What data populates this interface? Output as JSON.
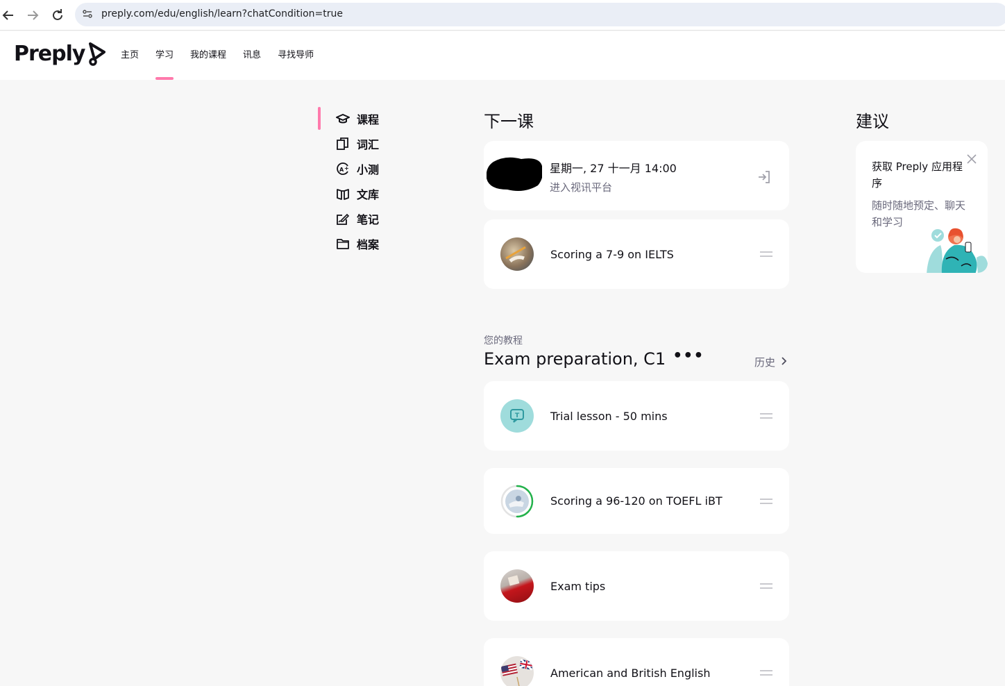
{
  "browser": {
    "url": "preply.com/edu/english/learn?chatCondition=true"
  },
  "header": {
    "logo_text": "Preply",
    "nav": [
      {
        "label": "主页",
        "active": false
      },
      {
        "label": "学习",
        "active": true
      },
      {
        "label": "我的课程",
        "active": false
      },
      {
        "label": "讯息",
        "active": false
      },
      {
        "label": "寻找导师",
        "active": false
      }
    ]
  },
  "sidebar": {
    "items": [
      {
        "label": "课程",
        "icon": "graduation-cap-icon",
        "active": true
      },
      {
        "label": "词汇",
        "icon": "cards-icon",
        "active": false
      },
      {
        "label": "小测",
        "icon": "quiz-icon",
        "active": false
      },
      {
        "label": "文库",
        "icon": "book-icon",
        "active": false
      },
      {
        "label": "笔记",
        "icon": "notes-icon",
        "active": false
      },
      {
        "label": "档案",
        "icon": "folder-icon",
        "active": false
      }
    ]
  },
  "next_lesson": {
    "section_title": "下一课",
    "date": "星期一, 27 十一月 14:00",
    "join_label": "进入视讯平台",
    "material_title": "Scoring a 7-9 on IELTS"
  },
  "course": {
    "label": "您的教程",
    "title": "Exam preparation, C1",
    "more": "•••",
    "history_label": "历史",
    "items": [
      {
        "title": "Trial lesson - 50 mins",
        "icon": "trial-lesson-icon"
      },
      {
        "title": "Scoring a 96-120 on TOEFL iBT",
        "progress": 0.5
      },
      {
        "title": "Exam tips"
      },
      {
        "title": "American and British English"
      }
    ]
  },
  "suggestions": {
    "section_title": "建议",
    "card_title": "获取 Preply 应用程序",
    "card_desc": "随时随地预定、聊天和学习"
  },
  "colors": {
    "accent_pink": "#ff7aac",
    "progress_green": "#23b24b",
    "trial_teal": "#9fdcdc"
  }
}
